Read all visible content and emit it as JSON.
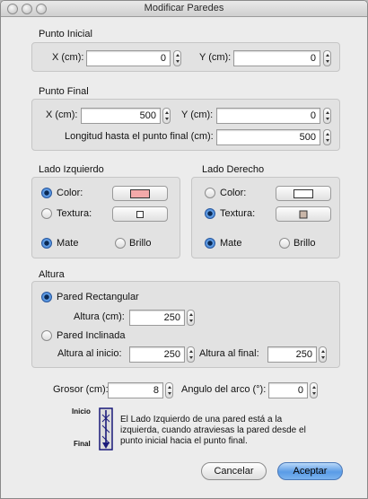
{
  "window": {
    "title": "Modificar Paredes"
  },
  "start_point": {
    "title": "Punto Inicial",
    "x_label": "X (cm):",
    "x_value": "0",
    "y_label": "Y (cm):",
    "y_value": "0"
  },
  "end_point": {
    "title": "Punto Final",
    "x_label": "X (cm):",
    "x_value": "500",
    "y_label": "Y (cm):",
    "y_value": "0",
    "length_label": "Longitud hasta el punto final (cm):",
    "length_value": "500"
  },
  "left_side": {
    "title": "Lado Izquierdo",
    "color_label": "Color:",
    "texture_label": "Textura:",
    "matte_label": "Mate",
    "gloss_label": "Brillo",
    "selected_paint": "color",
    "selected_finish": "matte",
    "color_swatch": "#f3a9a9",
    "texture_swatch": "#ffffff"
  },
  "right_side": {
    "title": "Lado Derecho",
    "color_label": "Color:",
    "texture_label": "Textura:",
    "matte_label": "Mate",
    "gloss_label": "Brillo",
    "selected_paint": "texture",
    "selected_finish": "matte",
    "color_swatch": "#ffffff",
    "texture_swatch": "#c9b6a8"
  },
  "height": {
    "title": "Altura",
    "rect_label": "Pared Rectangular",
    "rect_height_label": "Altura (cm):",
    "rect_height_value": "250",
    "sloped_label": "Pared Inclinada",
    "start_height_label": "Altura al inicio:",
    "start_height_value": "250",
    "end_height_label": "Altura al final:",
    "end_height_value": "250",
    "selected": "rect"
  },
  "thickness": {
    "label": "Grosor (cm):",
    "value": "8"
  },
  "arc": {
    "label": "Angulo del arco (°):",
    "value": "0"
  },
  "diagram": {
    "start_label": "Inicio",
    "end_label": "Final",
    "text": "El Lado Izquierdo de una pared está a la izquierda, cuando atraviesas la pared desde el punto inicial hacia el punto final."
  },
  "buttons": {
    "cancel": "Cancelar",
    "accept": "Aceptar"
  },
  "colors": {
    "accent": "#5a9be6",
    "group_bg": "#e2e2e2",
    "window_bg": "#ececec"
  }
}
